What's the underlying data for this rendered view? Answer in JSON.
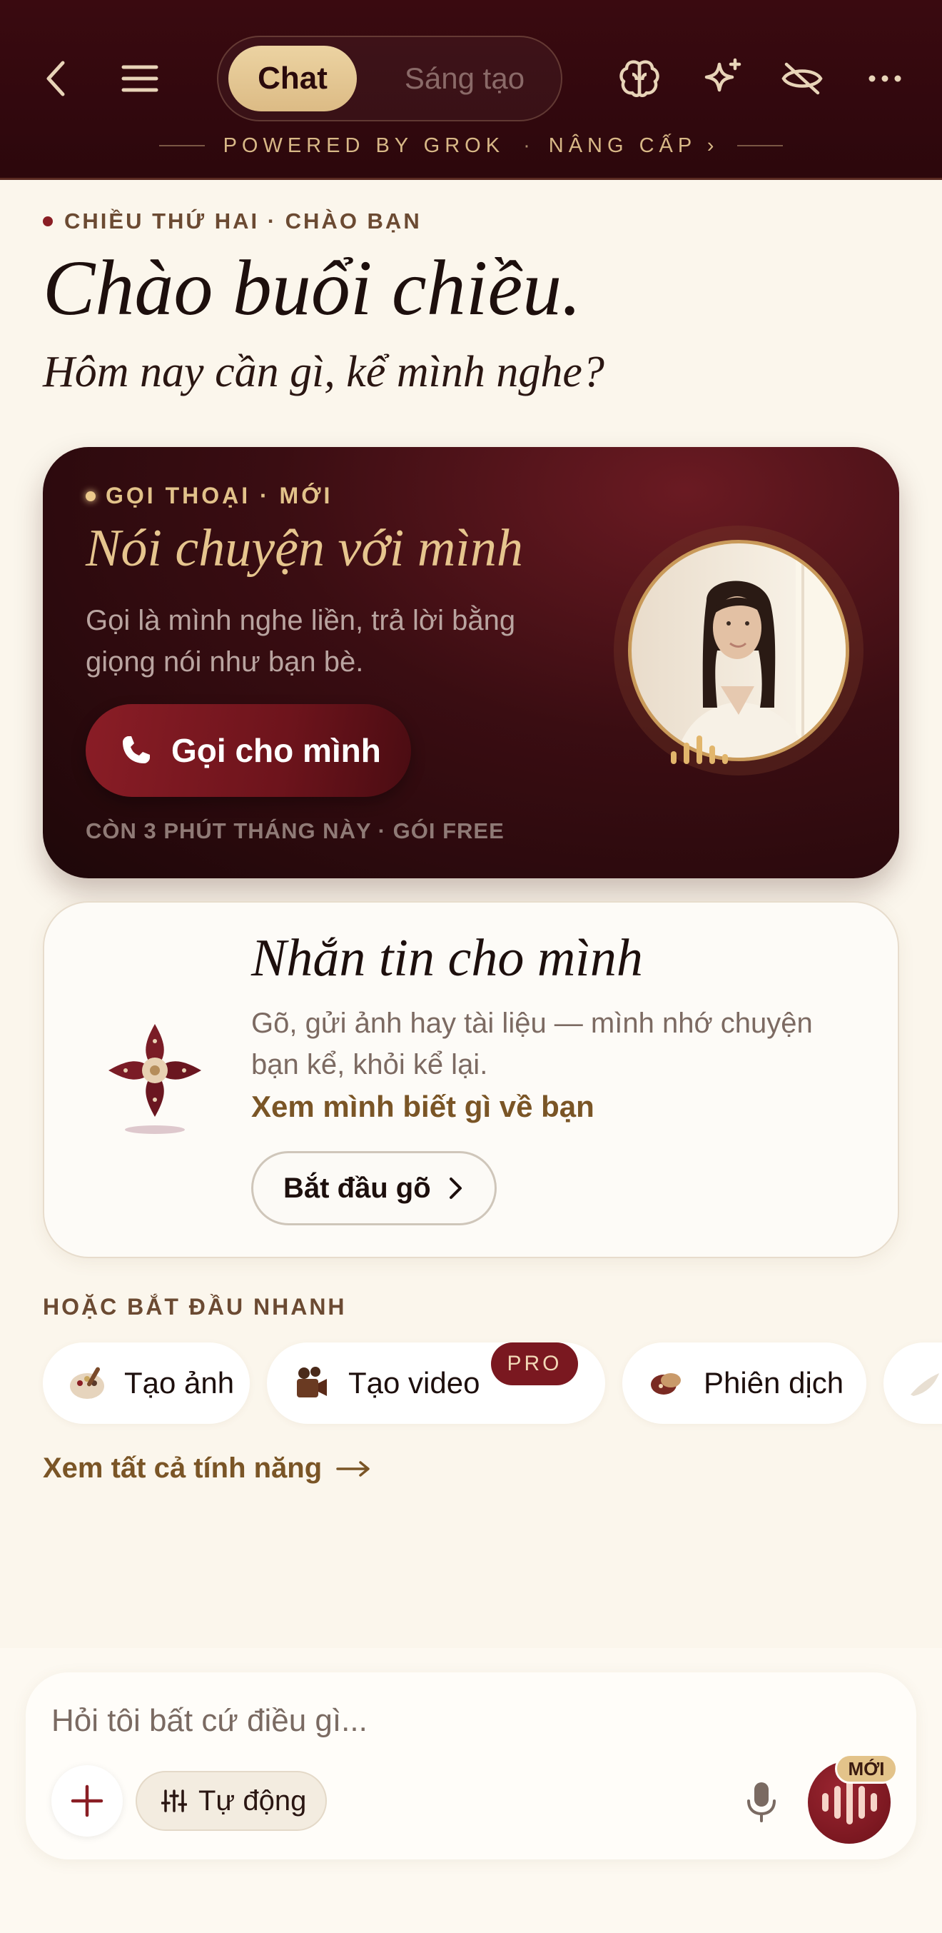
{
  "header": {
    "tab_active": "Chat",
    "tab_other": "Sáng tạo",
    "powered_by": "POWERED BY GROK",
    "separator": "·",
    "upgrade": "NÂNG CẤP ›",
    "icons": [
      "back-icon",
      "menu-icon",
      "brain-icon",
      "sparkle-icon",
      "hidden-eye-icon",
      "more-icon"
    ]
  },
  "greeting": {
    "eyebrow": "CHIỀU THỨ HAI · CHÀO BẠN",
    "title": "Chào buổi chiều.",
    "subtitle": "Hôm nay cần gì, kể mình nghe?"
  },
  "call_card": {
    "eyebrow": "GỌI THOẠI · MỚI",
    "title": "Nói chuyện với mình",
    "description": "Gọi là mình nghe liền, trả lời bằng giọng nói như bạn bè.",
    "button": "Gọi cho mình",
    "footer": "CÒN 3 PHÚT THÁNG NÀY · GÓI FREE"
  },
  "text_card": {
    "title": "Nhắn tin cho mình",
    "description": "Gõ, gửi ảnh hay tài liệu — mình nhớ chuyện bạn kể, khỏi kể lại.",
    "link": "Xem mình biết gì về bạn",
    "button": "Bắt đầu gõ"
  },
  "quick": {
    "label": "HOẶC BẮT ĐẦU NHANH",
    "chips": [
      {
        "label": "Tạo ảnh",
        "icon": "palette-icon"
      },
      {
        "label": "Tạo video",
        "icon": "film-icon",
        "badge": "PRO"
      },
      {
        "label": "Phiên dịch",
        "icon": "translate-icon"
      }
    ],
    "see_all": "Xem tất cả tính năng"
  },
  "composer": {
    "placeholder": "Hỏi tôi bất cứ điều gì...",
    "mode": "Tự động",
    "new_badge": "MỚI"
  },
  "colors": {
    "header_bg": "#2c070c",
    "accent_gold": "#e6c58e",
    "accent_maroon": "#7a1820",
    "background": "#fbf6ec"
  }
}
